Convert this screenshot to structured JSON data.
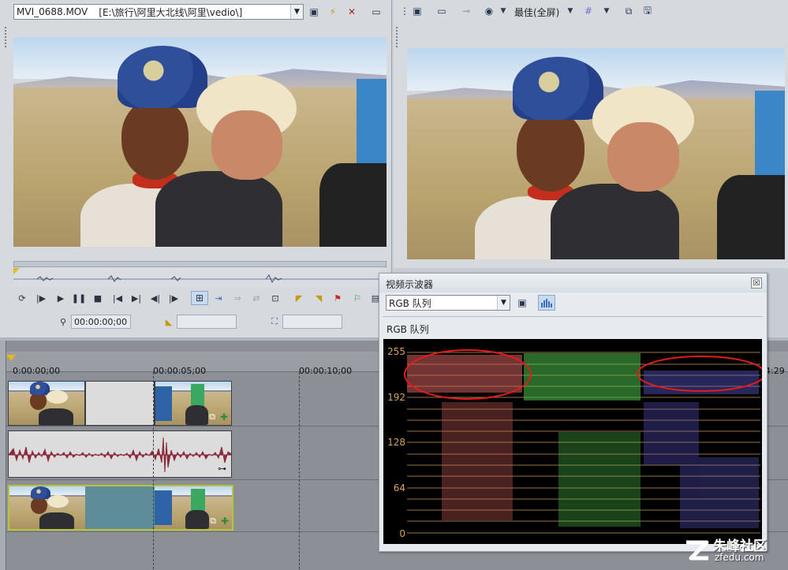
{
  "trimmer": {
    "clip_name": "MVI_0688.MOV",
    "clip_path": "[E:\\旅行\\阿里大北线\\阿里\\vedio\\]",
    "time_position": "00:00:00;00"
  },
  "preview": {
    "quality_label": "最佳(全屏)"
  },
  "timeline": {
    "ruler": [
      "0:00:00;00",
      "00:00:05;00",
      "00:00:10;00",
      "4:29"
    ]
  },
  "scope": {
    "window_title": "视频示波器",
    "mode_selected": "RGB 队列",
    "mode_caption": "RGB 队列",
    "close_symbol": "☒",
    "y_labels": [
      "255",
      "192",
      "128",
      "64",
      "0"
    ]
  },
  "watermark": {
    "text_cn": "朱峰社区",
    "text_en": "zfedu.com"
  },
  "colors": {
    "scope_label": "#d8a45a",
    "scope_red": "#d25f5f",
    "scope_green": "#4cc04c",
    "scope_blue": "#5a55c6",
    "highlight_ellipse": "#e31b1b",
    "clip_border_selected": "#b6c63b",
    "audio_wave": "#8a2a3c"
  }
}
